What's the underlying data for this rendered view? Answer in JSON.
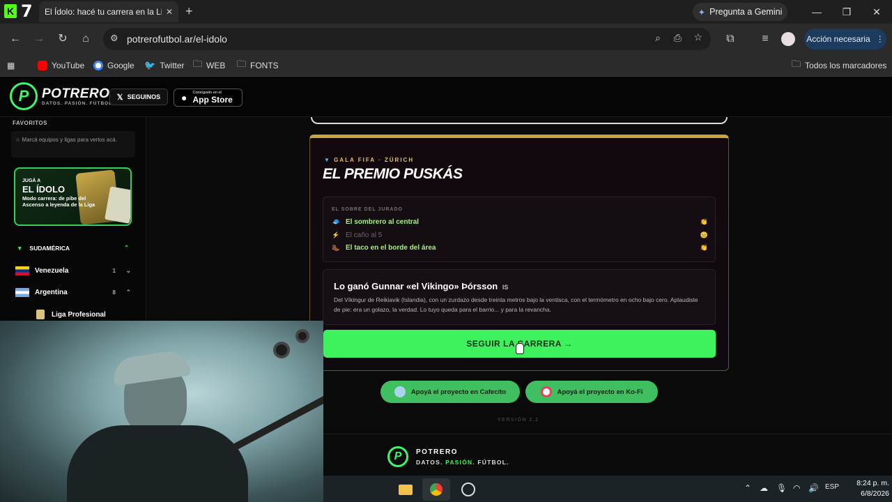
{
  "browser": {
    "tab_title": "El Ídolo: hacé tu carrera en la Li",
    "gemini_label": "Pregunta a Gemini",
    "url": "potrerofutbol.ar/el-idolo",
    "action_label": "Acción necesaria",
    "bookmarks": [
      "YouTube",
      "Google",
      "Twitter",
      "WEB",
      "FONTS"
    ],
    "all_bookmarks": "Todos los marcadores",
    "brand_k": "K",
    "brand_7": "7"
  },
  "site": {
    "logo_name": "POTRERO",
    "logo_tagline": "DATOS. PASIÓN. FÚTBOL.",
    "follow_label": "SEGUINOS",
    "appstore_small": "Consíguelo en el",
    "appstore_big": "App Store"
  },
  "sidebar": {
    "favorites_title": "FAVORITOS",
    "favorites_hint": "Marcá equipos y ligas para verlos acá.",
    "promo": {
      "line1": "JUGÁ A",
      "line2": "EL ÍDOLO",
      "line3": "Modo carrera: de pibe del Ascenso a leyenda de la Liga"
    },
    "region": "SUDAMÉRICA",
    "countries": [
      {
        "name": "Venezuela",
        "count": "1",
        "chevron": "⌄"
      },
      {
        "name": "Argentina",
        "count": "8",
        "chevron": "⌃"
      }
    ],
    "league": "Liga Profesional"
  },
  "event": {
    "kicker": "GALA FIFA · ZÜRICH",
    "title": "EL PREMIO PUSKÁS",
    "jury_title": "EL SOBRE DEL JURADO",
    "jury_items": [
      {
        "icon": "🧢",
        "label": "El sombrero al central",
        "result": "👏",
        "color": "#a6f07c"
      },
      {
        "icon": "⚡",
        "label": "El caño al 5",
        "result": "😐",
        "color": "#6e6669"
      },
      {
        "icon": "🥾",
        "label": "El taco en el borde del área",
        "result": "👏",
        "color": "#a6f07c"
      }
    ],
    "winner_title": "Lo ganó Gunnar «el Vikingo» Þórsson",
    "winner_flag": "IS",
    "winner_desc": "Del Víkingur de Reikiavik (Islandia), con un zurdazo desde treinta metros bajo la ventisca, con el termómetro en ocho bajo cero. Aplaudiste de pie: era un golazo, la verdad. Lo tuyo queda para el barrio... y para la revancha.",
    "cta": "SEGUIR LA CARRERA →"
  },
  "support": {
    "cafecito": "Apoyá el proyecto en Cafecito",
    "kofi": "Apoyá el proyecto en Ko-Fi"
  },
  "version": "VERSIÓN 2.2",
  "footer": {
    "name": "POTRERO",
    "tag_a": "DATOS. ",
    "tag_b": "PASIÓN",
    "tag_c": ". FÚTBOL."
  },
  "taskbar": {
    "lang": "ESP",
    "time": "8:24 p. m.",
    "date": "6/8/2026"
  },
  "colors": {
    "accent_green": "#3ef25d",
    "gold": "#c9a53a",
    "kofi_red": "#e0455a"
  }
}
